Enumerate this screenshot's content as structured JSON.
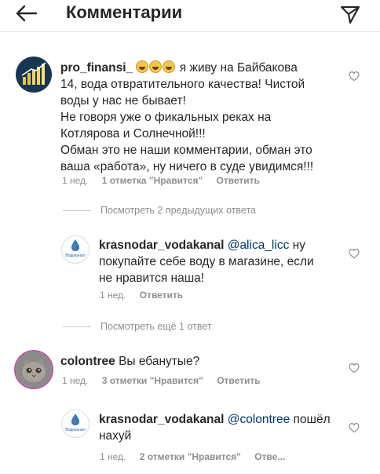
{
  "header": {
    "title": "Комментарии",
    "back_icon": "arrow-left-icon",
    "send_icon": "send-icon"
  },
  "comments": [
    {
      "username": "pro_finansi_",
      "emoji_count": 3,
      "lines": [
        "я живу на Байбакова",
        "14, вода отвратительного качества! Чистой",
        "воды у нас не бывает!",
        "Не говоря уже о фикальных реках на",
        "Котлярова и Солнечной!!!",
        "Обман это не наши комментарии, обман это",
        "ваша «работа», ну ничего в суде увидимся!!!"
      ],
      "time": "1 нед.",
      "likes": "1 отметка \"Нравится\"",
      "reply": "Ответить"
    },
    {
      "toggle": "Посмотреть 2 предыдущих ответа"
    },
    {
      "username": "krasnodar_vodakanal",
      "mention": "@alica_licc",
      "lines": [
        "ну",
        "покупайте себе воду в магазине, если",
        "не нравится наша!"
      ],
      "time": "1 нед.",
      "reply": "Ответить"
    },
    {
      "toggle": "Посмотреть ещё 1 ответ"
    },
    {
      "username": "colontree",
      "lines": [
        "Вы ебанутые?"
      ],
      "time": "1 нед.",
      "likes": "3 отметки \"Нравится\"",
      "reply": "Ответить"
    },
    {
      "username": "krasnodar_vodakanal",
      "mention": "@colontree",
      "lines": [
        "пошёл",
        "нахуй"
      ],
      "time": "1 нед.",
      "likes": "2 отметки \"Нравится\"",
      "reply": "Отве..."
    }
  ],
  "avatar_logo_text": "Водоканал"
}
